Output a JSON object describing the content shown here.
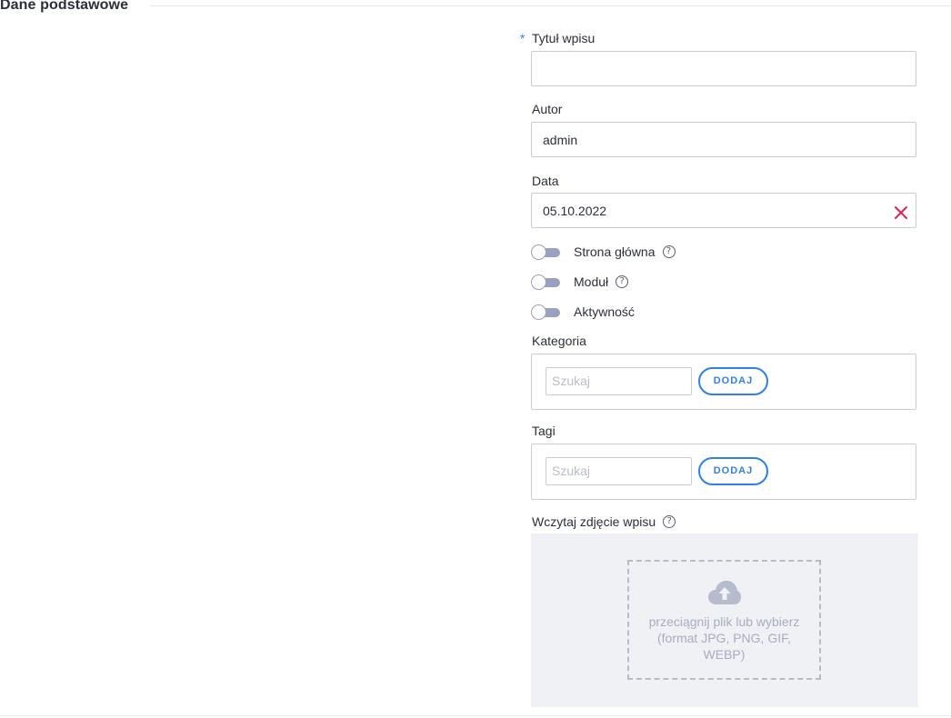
{
  "section": {
    "title": "Dane podstawowe"
  },
  "form": {
    "title": {
      "required_mark": "*",
      "label": "Tytuł wpisu",
      "value": ""
    },
    "author": {
      "label": "Autor",
      "value": "admin"
    },
    "date": {
      "label": "Data",
      "value": "05.10.2022"
    },
    "toggles": [
      {
        "label": "Strona główna",
        "help": "?",
        "on": false
      },
      {
        "label": "Moduł",
        "help": "?",
        "on": false
      },
      {
        "label": "Aktywność",
        "on": false
      }
    ],
    "category": {
      "label": "Kategoria",
      "search_placeholder": "Szukaj",
      "add_label": "DODAJ"
    },
    "tags": {
      "label": "Tagi",
      "search_placeholder": "Szukaj",
      "add_label": "DODAJ"
    },
    "image": {
      "label": "Wczytaj zdjęcie wpisu",
      "help": "?",
      "line1": "przeciągnij plik lub wybierz",
      "line2": "(format JPG, PNG, GIF,",
      "line3": "WEBP)"
    }
  },
  "colors": {
    "accent": "#2f80ed",
    "clear": "#e0264f",
    "toggle_off": "#9aa0c0",
    "upload_bg": "#f0f1f5"
  },
  "icons": {
    "clear": "close-icon",
    "help": "help-circle-icon",
    "upload": "cloud-upload-icon"
  }
}
